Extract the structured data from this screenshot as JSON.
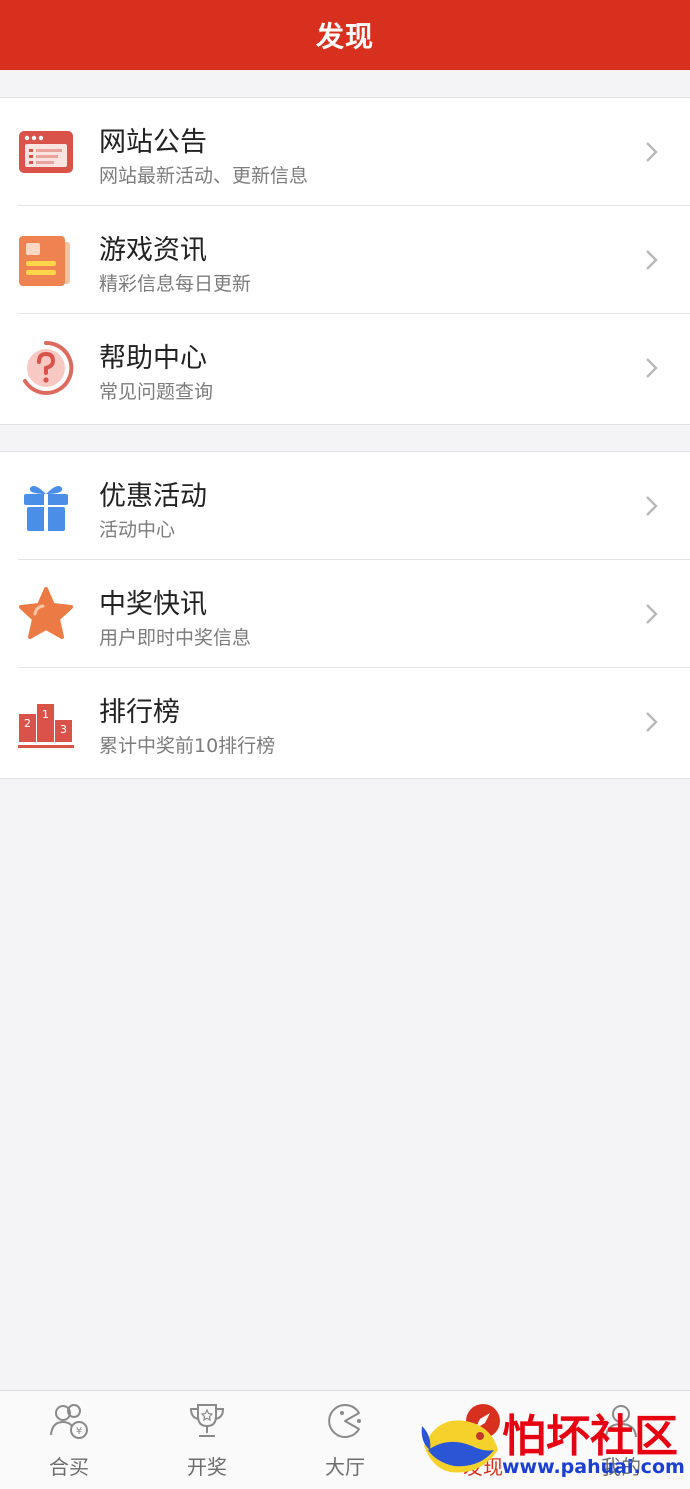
{
  "header": {
    "title": "发现"
  },
  "groups": [
    {
      "items": [
        {
          "title": "网站公告",
          "subtitle": "网站最新活动、更新信息",
          "icon": "announcement-browser-icon"
        },
        {
          "title": "游戏资讯",
          "subtitle": "精彩信息每日更新",
          "icon": "news-card-icon"
        },
        {
          "title": "帮助中心",
          "subtitle": "常见问题查询",
          "icon": "help-question-icon"
        }
      ]
    },
    {
      "items": [
        {
          "title": "优惠活动",
          "subtitle": "活动中心",
          "icon": "gift-icon"
        },
        {
          "title": "中奖快讯",
          "subtitle": "用户即时中奖信息",
          "icon": "star-icon"
        },
        {
          "title": "排行榜",
          "subtitle": "累计中奖前10排行榜",
          "icon": "podium-icon"
        }
      ]
    }
  ],
  "tabbar": {
    "tabs": [
      {
        "label": "合买",
        "icon": "group-buy-icon"
      },
      {
        "label": "开奖",
        "icon": "trophy-icon"
      },
      {
        "label": "大厅",
        "icon": "lobby-pacman-icon"
      },
      {
        "label": "发现",
        "icon": "discover-compass-icon",
        "active": true
      },
      {
        "label": "我的",
        "icon": "profile-icon"
      }
    ]
  },
  "watermark": {
    "text": "怕坏社区",
    "url": "www.pahuai.com"
  },
  "colors": {
    "brand": "#d7301f",
    "background": "#f4f4f6"
  }
}
